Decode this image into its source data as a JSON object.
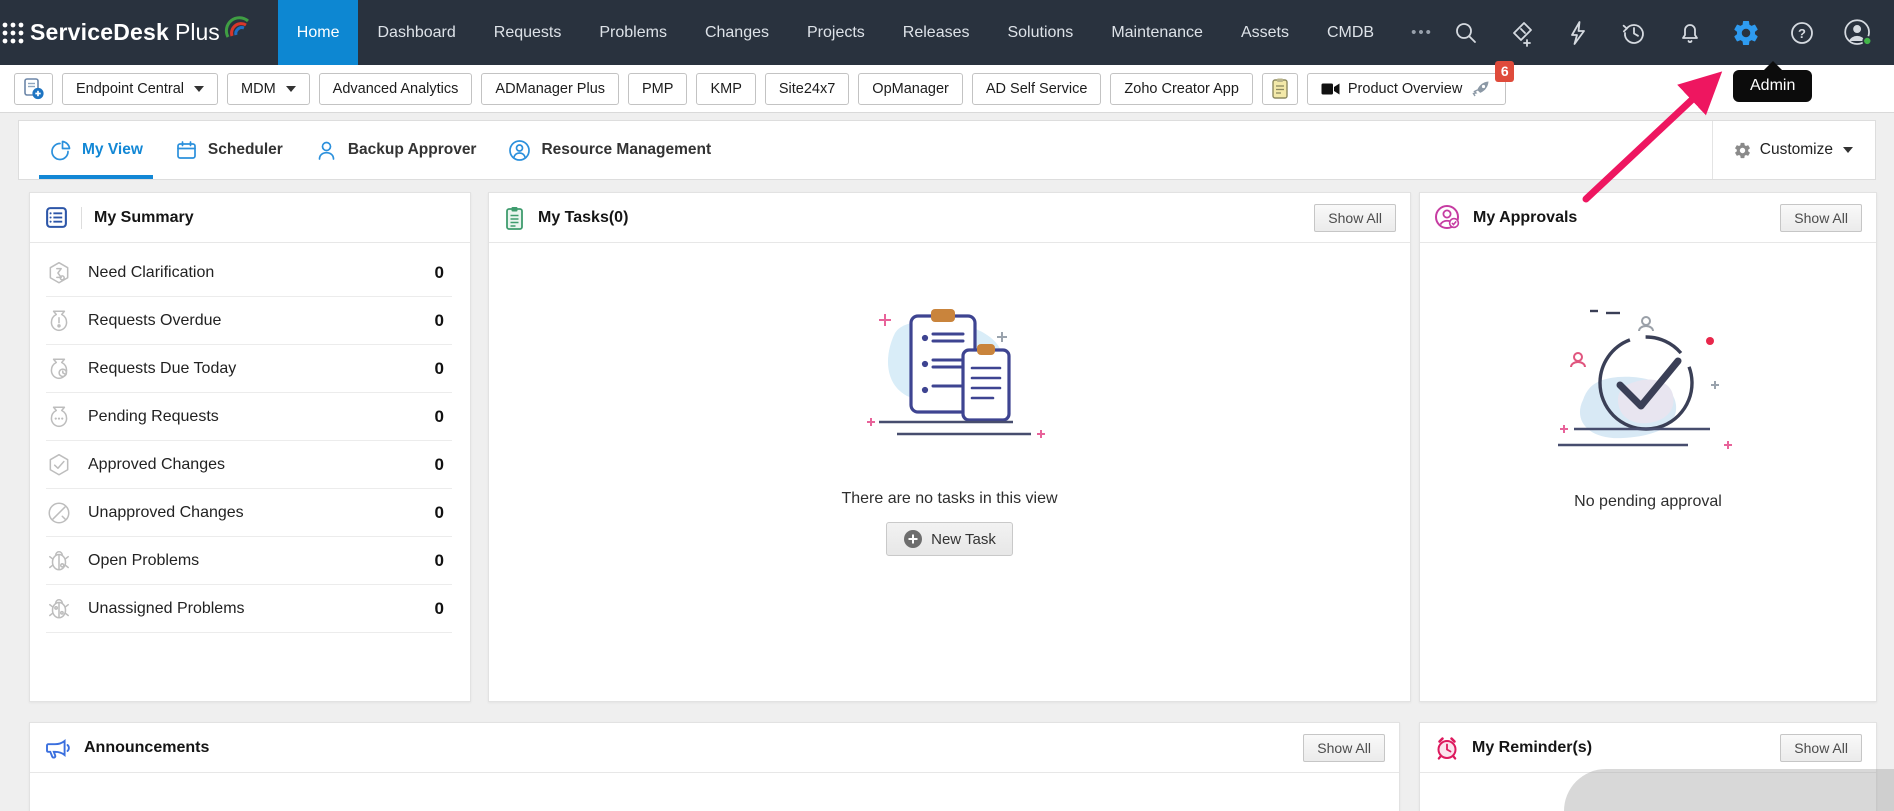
{
  "topbar": {
    "brand": {
      "bold": "ServiceDesk",
      "light": "Plus"
    },
    "nav": [
      {
        "label": "Home",
        "active": true
      },
      {
        "label": "Dashboard"
      },
      {
        "label": "Requests"
      },
      {
        "label": "Problems"
      },
      {
        "label": "Changes"
      },
      {
        "label": "Projects"
      },
      {
        "label": "Releases"
      },
      {
        "label": "Solutions"
      },
      {
        "label": "Maintenance"
      },
      {
        "label": "Assets"
      },
      {
        "label": "CMDB"
      }
    ],
    "more_label": "•••",
    "icons": [
      "search-icon",
      "ticket-add-icon",
      "quick-actions-lightning-icon",
      "history-icon",
      "notifications-bell-icon",
      "settings-gear-icon",
      "help-icon",
      "user-avatar"
    ]
  },
  "toolbar": {
    "apps": [
      {
        "label": "Endpoint Central",
        "dropdown": true
      },
      {
        "label": "MDM",
        "dropdown": true
      },
      {
        "label": "Advanced Analytics"
      },
      {
        "label": "ADManager Plus"
      },
      {
        "label": "PMP"
      },
      {
        "label": "KMP"
      },
      {
        "label": "Site24x7"
      },
      {
        "label": "OpManager"
      },
      {
        "label": "AD Self Service"
      },
      {
        "label": "Zoho Creator App"
      }
    ],
    "product_overview": {
      "label": "Product Overview",
      "badge": "6"
    }
  },
  "admin_tooltip": {
    "label": "Admin"
  },
  "tabs": {
    "items": [
      {
        "label": "My View",
        "active": true
      },
      {
        "label": "Scheduler"
      },
      {
        "label": "Backup Approver"
      },
      {
        "label": "Resource Management"
      }
    ],
    "customize_label": "Customize"
  },
  "panels": {
    "my_summary": {
      "title": "My Summary",
      "rows": [
        {
          "label": "Need Clarification",
          "count": "0"
        },
        {
          "label": "Requests Overdue",
          "count": "0"
        },
        {
          "label": "Requests Due Today",
          "count": "0"
        },
        {
          "label": "Pending Requests",
          "count": "0"
        },
        {
          "label": "Approved Changes",
          "count": "0"
        },
        {
          "label": "Unapproved Changes",
          "count": "0"
        },
        {
          "label": "Open Problems",
          "count": "0"
        },
        {
          "label": "Unassigned Problems",
          "count": "0"
        }
      ]
    },
    "my_tasks": {
      "title": "My Tasks(0)",
      "show_all": "Show All",
      "empty_text": "There are no tasks in this view",
      "new_task_label": "New Task"
    },
    "my_approvals": {
      "title": "My Approvals",
      "show_all": "Show All",
      "empty_text": "No pending approval"
    },
    "announcements": {
      "title": "Announcements",
      "show_all": "Show All"
    },
    "my_reminders": {
      "title": "My Reminder(s)",
      "show_all": "Show All"
    }
  },
  "colors": {
    "topbar_bg": "#29323e",
    "active_nav_blue": "#0d87d2",
    "accent_blue": "#1287d5",
    "gear_highlight_blue": "#2e9bf0",
    "badge_red": "#df4b3b",
    "arrow_pink": "#ee1660",
    "tooltip_bg": "#0c0c0c",
    "approvals_magenta": "#c63ca2",
    "reminders_crimson": "#dd1a5e",
    "tasks_green": "#3f9c6e",
    "summary_blue": "#2d56a8",
    "announcements_blue": "#3a6fde",
    "avatar_status_green": "#43b649"
  }
}
